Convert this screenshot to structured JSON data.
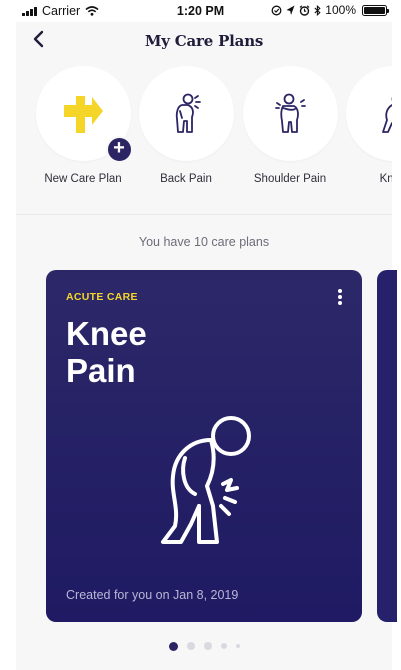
{
  "status_bar": {
    "carrier": "Carrier",
    "time": "1:20 PM",
    "battery": "100%"
  },
  "nav": {
    "title": "My Care Plans"
  },
  "plans": [
    {
      "label": "New Care Plan",
      "icon": "add-plan-icon"
    },
    {
      "label": "Back Pain",
      "icon": "back-pain-icon"
    },
    {
      "label": "Shoulder Pain",
      "icon": "shoulder-pain-icon"
    },
    {
      "label": "Knee",
      "icon": "knee-pain-icon"
    }
  ],
  "summary": {
    "count_text": "You have 10 care plans"
  },
  "card": {
    "tag": "ACUTE CARE",
    "title_line1": "Knee",
    "title_line2": "Pain",
    "footer": "Created for you on Jan 8, 2019"
  },
  "pagination": {
    "current": 1,
    "total": 5
  },
  "colors": {
    "accent": "#f5d628",
    "brand": "#2c2868",
    "card_bg": "#221d66"
  }
}
